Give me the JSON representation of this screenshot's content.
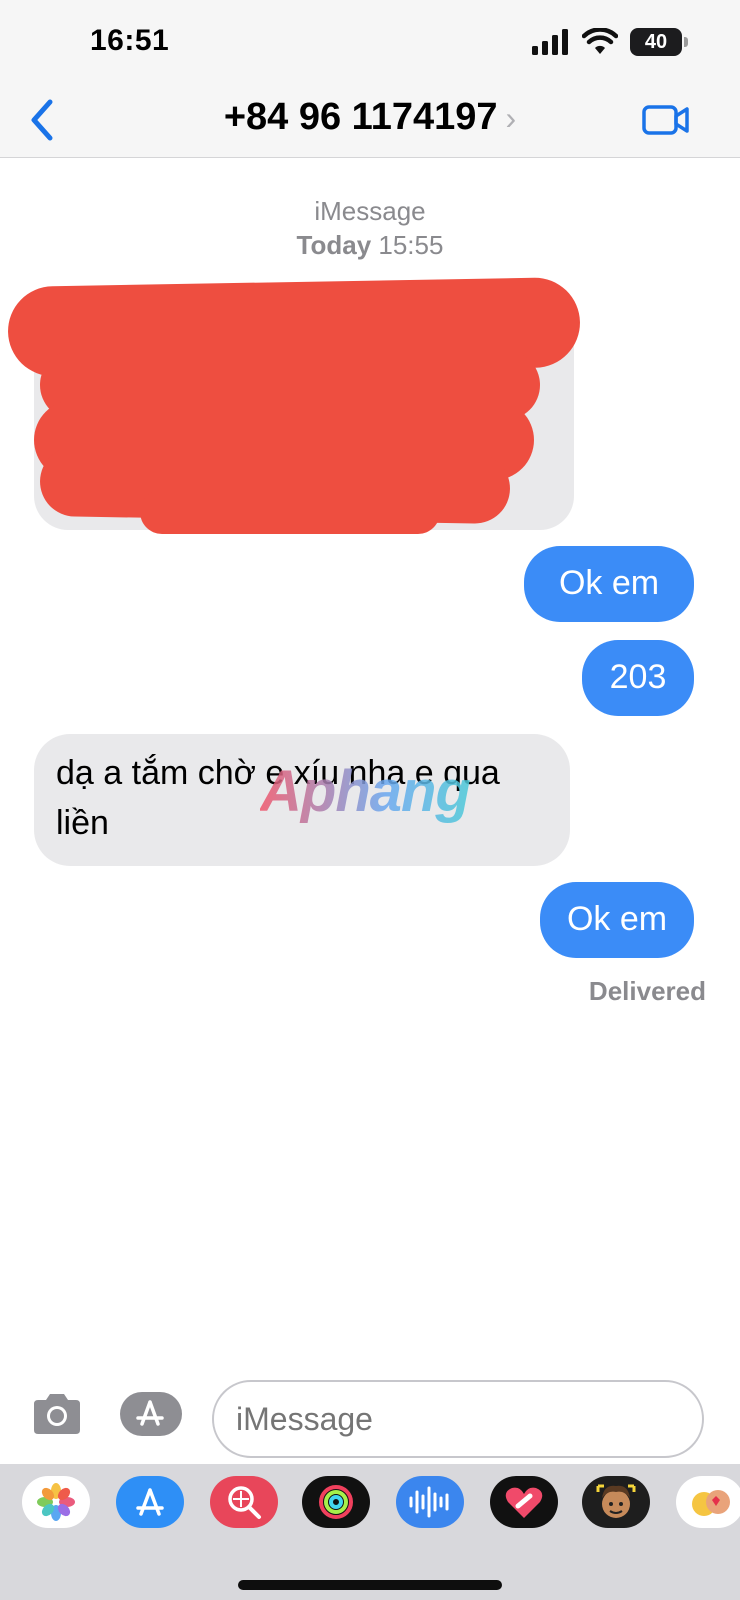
{
  "status_bar": {
    "time": "16:51",
    "battery": "40"
  },
  "header": {
    "contact": "+84 96 1174197",
    "chevron": "›"
  },
  "thread": {
    "service": "iMessage",
    "date_label": "Today",
    "time_label": "15:55"
  },
  "messages": [
    {
      "from": "them",
      "text": "",
      "redacted": true
    },
    {
      "from": "me",
      "text": "Ok em"
    },
    {
      "from": "me",
      "text": "203"
    },
    {
      "from": "them",
      "text": "dạ a tắm chờ e xíu nha e qua liền"
    },
    {
      "from": "me",
      "text": "Ok em"
    }
  ],
  "delivered": "Delivered",
  "watermark": "Aphang",
  "composer": {
    "placeholder": "iMessage"
  },
  "icons": [
    "back-chevron-icon",
    "video-camera-icon",
    "camera-icon",
    "app-store-icon",
    "photos-icon",
    "images-search-icon",
    "activity-icon",
    "audio-icon",
    "digital-touch-icon",
    "memoji-icon"
  ],
  "colors": {
    "outgoing": "#3b8cf7",
    "incoming": "#e9e9eb",
    "accent": "#1a73e8",
    "redaction": "#ee4e40"
  }
}
